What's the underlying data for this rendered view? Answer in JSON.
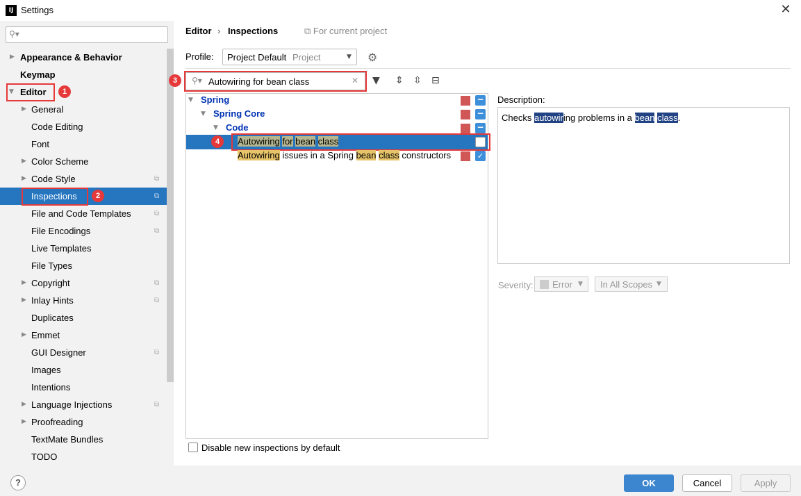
{
  "window": {
    "title": "Settings",
    "app_icon": "IJ"
  },
  "sidebar": {
    "search_placeholder": "",
    "items": [
      {
        "label": "Appearance & Behavior"
      },
      {
        "label": "Keymap"
      },
      {
        "label": "Editor"
      },
      {
        "label": "General"
      },
      {
        "label": "Code Editing"
      },
      {
        "label": "Font"
      },
      {
        "label": "Color Scheme"
      },
      {
        "label": "Code Style"
      },
      {
        "label": "Inspections"
      },
      {
        "label": "File and Code Templates"
      },
      {
        "label": "File Encodings"
      },
      {
        "label": "Live Templates"
      },
      {
        "label": "File Types"
      },
      {
        "label": "Copyright"
      },
      {
        "label": "Inlay Hints"
      },
      {
        "label": "Duplicates"
      },
      {
        "label": "Emmet"
      },
      {
        "label": "GUI Designer"
      },
      {
        "label": "Images"
      },
      {
        "label": "Intentions"
      },
      {
        "label": "Language Injections"
      },
      {
        "label": "Proofreading"
      },
      {
        "label": "TextMate Bundles"
      },
      {
        "label": "TODO"
      }
    ]
  },
  "annotations": {
    "b1": "1",
    "b2": "2",
    "b3": "3",
    "b4": "4"
  },
  "header": {
    "crumb1": "Editor",
    "sep": "›",
    "crumb2": "Inspections",
    "for_project": "For current project"
  },
  "profile": {
    "label": "Profile:",
    "value": "Project Default",
    "scope": "Project"
  },
  "search": {
    "value": "Autowiring for bean class"
  },
  "tree": {
    "spring": "Spring",
    "spring_core": "Spring Core",
    "code": "Code",
    "row1": {
      "w1": "Autowiring",
      "w2": "for",
      "w3": "bean",
      "w4": "class"
    },
    "row2": {
      "w1": "Autowiring",
      "t1": " issues in a Spring ",
      "w2": "bean",
      "w3": "class",
      "t2": " constructors"
    }
  },
  "description": {
    "label": "Description:",
    "t1": "Checks ",
    "h1": "autowir",
    "t2": "ing problems in a ",
    "h2": "bean",
    "h3": "class",
    "t3": "."
  },
  "severity": {
    "label": "Severity:",
    "value": "Error",
    "scope": "In All Scopes"
  },
  "disable_new": "Disable new inspections by default",
  "footer": {
    "help": "?",
    "ok": "OK",
    "cancel": "Cancel",
    "apply": "Apply"
  }
}
